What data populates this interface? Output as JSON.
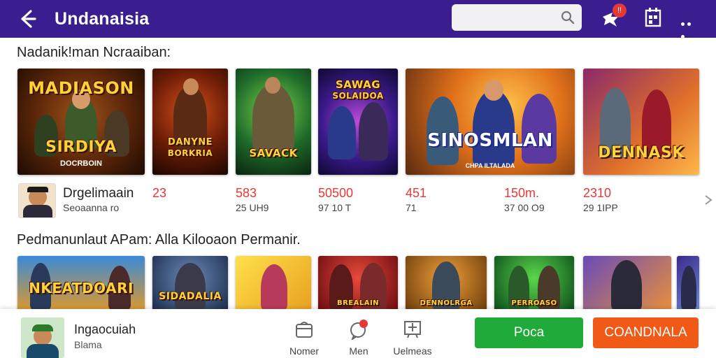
{
  "header": {
    "title": "Undanaisia",
    "notification_count": "!!",
    "search_placeholder": ""
  },
  "colors": {
    "topbar": "#3a1d8f",
    "accent_red": "#e53935",
    "green_button": "#1faa3a",
    "orange_button": "#f05a16"
  },
  "icons": [
    "back-arrow-icon",
    "search-icon",
    "notification-icon",
    "calendar-icon",
    "more-icon"
  ],
  "section1": {
    "title": "Nadanik!man Ncraaiban:",
    "cards": [
      {
        "banner": "MADIASON",
        "banner2": "SIRDIYA",
        "sub": "DOCRBOIN"
      },
      {
        "banner": "DANYNE",
        "banner2": "BORKRIA",
        "sub": ""
      },
      {
        "banner": "SAVACK",
        "banner2": "",
        "sub": ""
      },
      {
        "banner": "SAWAG",
        "banner2": "SOLAIDOA",
        "sub": ""
      },
      {
        "banner": "SINOSMLAN",
        "banner2": "",
        "sub": "CHPA ILTALADA"
      },
      {
        "banner": "DENNASK",
        "banner2": "",
        "sub": ""
      }
    ]
  },
  "stats": {
    "hero_name": "Drgelimaain",
    "hero_sub": "Seoaanna ro",
    "items": [
      {
        "main": "23",
        "sub": ""
      },
      {
        "main": "583",
        "sub": "25 UH9"
      },
      {
        "main": "50500",
        "sub": "97 10 T"
      },
      {
        "main": "451",
        "sub": "71"
      },
      {
        "main": "150m.",
        "sub": "37 00 O9"
      },
      {
        "main": "2310",
        "sub": "29 1IPP"
      }
    ]
  },
  "section2": {
    "title": "Pedmanunlaut APam: Alla Kilooaon Permanir.",
    "cards": [
      {
        "banner": "NKEATDOARI"
      },
      {
        "banner": "SIDADALIA"
      },
      {
        "banner": ""
      },
      {
        "banner": "BREALAIN"
      },
      {
        "banner": "DENNOLRGA"
      },
      {
        "banner": "PERROASO"
      },
      {
        "banner": ""
      },
      {
        "banner": ""
      }
    ]
  },
  "bottom": {
    "user_name": "Ingaocuiah",
    "user_sub": "Blama",
    "nav": [
      {
        "label": "Nomer",
        "icon": "home-icon"
      },
      {
        "label": "Men",
        "icon": "chat-icon"
      },
      {
        "label": "Uelmeas",
        "icon": "store-icon"
      }
    ],
    "primary_button": "Poca",
    "secondary_button": "COANDNALA"
  }
}
